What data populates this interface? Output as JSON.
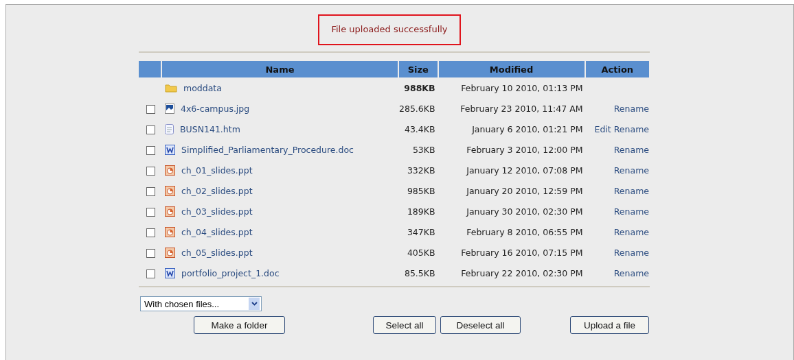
{
  "message": "File uploaded successfully",
  "table": {
    "columns": [
      "Name",
      "Size",
      "Modified",
      "Action"
    ],
    "rows": [
      {
        "kind": "folder",
        "name": "moddata",
        "size": "988KB",
        "modified": "February 10 2010, 01:13 PM",
        "actions": []
      },
      {
        "kind": "image",
        "checked": false,
        "name": "4x6-campus.jpg",
        "size": "285.6KB",
        "modified": "February 23 2010, 11:47 AM",
        "actions": [
          "Rename"
        ]
      },
      {
        "kind": "html",
        "checked": false,
        "name": "BUSN141.htm",
        "size": "43.4KB",
        "modified": "January 6 2010, 01:21 PM",
        "actions": [
          "Edit",
          "Rename"
        ]
      },
      {
        "kind": "word",
        "checked": false,
        "name": "Simplified_Parliamentary_Procedure.doc",
        "size": "53KB",
        "modified": "February 3 2010, 12:00 PM",
        "actions": [
          "Rename"
        ]
      },
      {
        "kind": "ppt",
        "checked": false,
        "name": "ch_01_slides.ppt",
        "size": "332KB",
        "modified": "January 12 2010, 07:08 PM",
        "actions": [
          "Rename"
        ]
      },
      {
        "kind": "ppt",
        "checked": false,
        "name": "ch_02_slides.ppt",
        "size": "985KB",
        "modified": "January 20 2010, 12:59 PM",
        "actions": [
          "Rename"
        ]
      },
      {
        "kind": "ppt",
        "checked": false,
        "name": "ch_03_slides.ppt",
        "size": "189KB",
        "modified": "January 30 2010, 02:30 PM",
        "actions": [
          "Rename"
        ]
      },
      {
        "kind": "ppt",
        "checked": false,
        "name": "ch_04_slides.ppt",
        "size": "347KB",
        "modified": "February 8 2010, 06:55 PM",
        "actions": [
          "Rename"
        ]
      },
      {
        "kind": "ppt",
        "checked": false,
        "name": "ch_05_slides.ppt",
        "size": "405KB",
        "modified": "February 16 2010, 07:15 PM",
        "actions": [
          "Rename"
        ]
      },
      {
        "kind": "word",
        "checked": false,
        "name": "portfolio_project_1.doc",
        "size": "85.5KB",
        "modified": "February 22 2010, 02:30 PM",
        "actions": [
          "Rename"
        ]
      }
    ]
  },
  "select": {
    "value": "With chosen files..."
  },
  "buttons": [
    "Make a folder",
    "Select all",
    "Deselect all",
    "Upload a file"
  ]
}
